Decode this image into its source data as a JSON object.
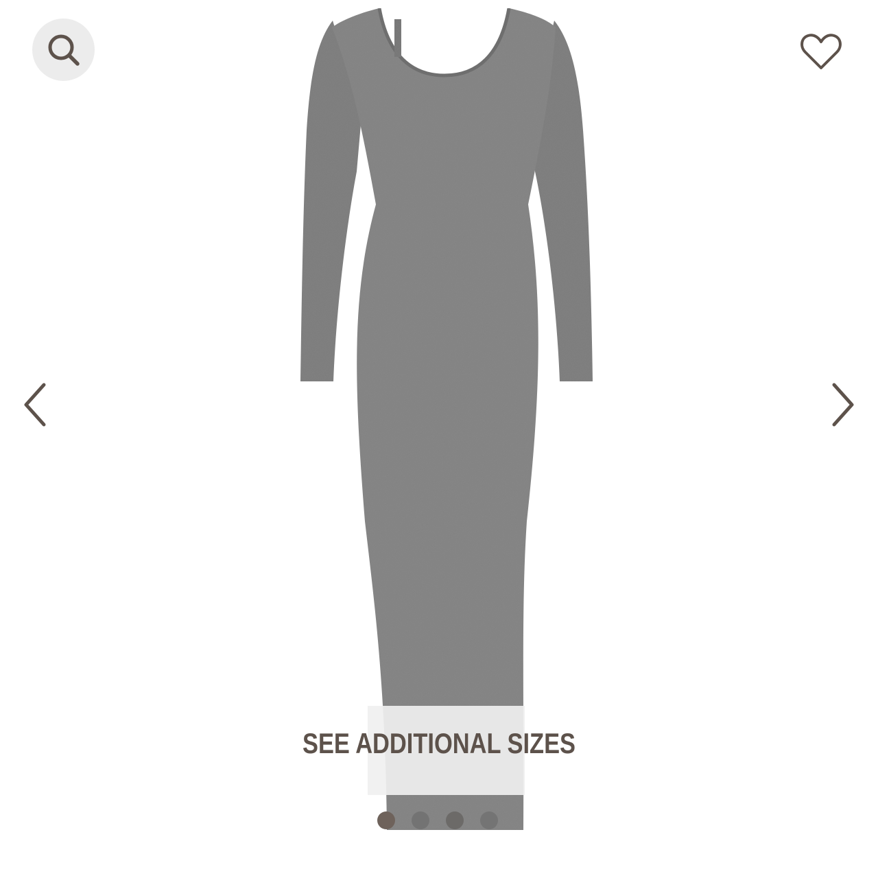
{
  "product": {
    "image_alt": "Long sleeve scoop neck maxi dress in heather grey",
    "dress_color": "#7f7f7f"
  },
  "header": {
    "search_icon": "search-icon",
    "favorite_icon": "heart-icon"
  },
  "carousel": {
    "prev_icon": "chevron-left-icon",
    "next_icon": "chevron-right-icon"
  },
  "sizes": {
    "cta_label": "SEE ADDITIONAL SIZES"
  },
  "swatches": [
    {
      "name": "swatch-1",
      "color": "#6e625b"
    },
    {
      "name": "swatch-2",
      "color": "#737373"
    },
    {
      "name": "swatch-3",
      "color": "#6c6a68"
    },
    {
      "name": "swatch-4",
      "color": "#747474"
    }
  ],
  "colors": {
    "icon": "#5d524b",
    "cta_text": "#5d524b",
    "search_bg": "#ececec"
  }
}
